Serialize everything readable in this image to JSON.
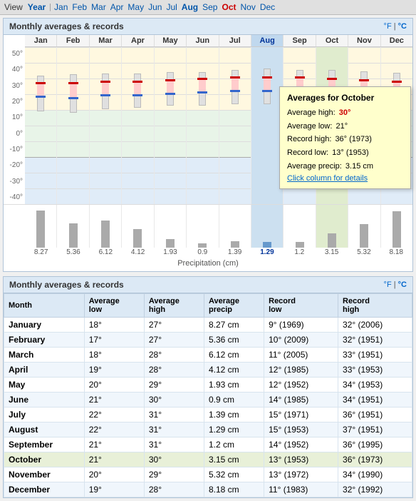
{
  "nav": {
    "view_label": "View",
    "year_label": "Year",
    "months": [
      "Jan",
      "Feb",
      "Mar",
      "Apr",
      "May",
      "Jun",
      "Jul",
      "Aug",
      "Sep",
      "Oct",
      "Nov",
      "Dec"
    ],
    "current_month": "Oct"
  },
  "chart": {
    "title": "Monthly averages & records",
    "temp_f": "°F",
    "temp_separator": " | ",
    "temp_c": "°C",
    "y_labels": [
      "50°",
      "40°",
      "30°",
      "20°",
      "10°",
      "0°",
      "-10°",
      "-20°",
      "-30°",
      "-40°"
    ],
    "months": [
      "Jan",
      "Feb",
      "Mar",
      "Apr",
      "May",
      "Jun",
      "Jul",
      "Aug",
      "Sep",
      "Oct",
      "Nov",
      "Dec"
    ],
    "highlighted_month": "Aug",
    "precip_title": "Precipitation (cm)",
    "precip_values": [
      "8.27",
      "5.36",
      "6.12",
      "4.12",
      "1.93",
      "0.9",
      "1.39",
      "1.29",
      "1.2",
      "3.15",
      "5.32",
      "8.18"
    ],
    "precip_heights": [
      52,
      34,
      38,
      26,
      12,
      6,
      9,
      8,
      8,
      20,
      33,
      51
    ]
  },
  "tooltip": {
    "title": "Averages for October",
    "avg_high_label": "Average high:",
    "avg_high_value": "30°",
    "avg_low_label": "Average low:",
    "avg_low_value": "21°",
    "record_high_label": "Record high:",
    "record_high_value": "36° (1973)",
    "record_low_label": "Record low:",
    "record_low_value": "13° (1953)",
    "avg_precip_label": "Average precip:",
    "avg_precip_value": "3.15 cm",
    "link_text": "Click column for details"
  },
  "table": {
    "title": "Monthly averages & records",
    "temp_f": "°F",
    "temp_separator": " | ",
    "temp_c": "°C",
    "headers": [
      "Month",
      "Average low",
      "Average high",
      "Average precip",
      "Record low",
      "Record high"
    ],
    "rows": [
      {
        "month": "January",
        "avg_low": "18°",
        "avg_high": "27°",
        "avg_precip": "8.27 cm",
        "record_low": "9° (1969)",
        "record_high": "32° (2006)"
      },
      {
        "month": "February",
        "avg_low": "17°",
        "avg_high": "27°",
        "avg_precip": "5.36 cm",
        "record_low": "10° (2009)",
        "record_high": "32° (1951)"
      },
      {
        "month": "March",
        "avg_low": "18°",
        "avg_high": "28°",
        "avg_precip": "6.12 cm",
        "record_low": "11° (2005)",
        "record_high": "33° (1951)"
      },
      {
        "month": "April",
        "avg_low": "19°",
        "avg_high": "28°",
        "avg_precip": "4.12 cm",
        "record_low": "12° (1985)",
        "record_high": "33° (1953)"
      },
      {
        "month": "May",
        "avg_low": "20°",
        "avg_high": "29°",
        "avg_precip": "1.93 cm",
        "record_low": "12° (1952)",
        "record_high": "34° (1953)"
      },
      {
        "month": "June",
        "avg_low": "21°",
        "avg_high": "30°",
        "avg_precip": "0.9 cm",
        "record_low": "14° (1985)",
        "record_high": "34° (1951)"
      },
      {
        "month": "July",
        "avg_low": "22°",
        "avg_high": "31°",
        "avg_precip": "1.39 cm",
        "record_low": "15° (1971)",
        "record_high": "36° (1951)"
      },
      {
        "month": "August",
        "avg_low": "22°",
        "avg_high": "31°",
        "avg_precip": "1.29 cm",
        "record_low": "15° (1953)",
        "record_high": "37° (1951)"
      },
      {
        "month": "September",
        "avg_low": "21°",
        "avg_high": "31°",
        "avg_precip": "1.2 cm",
        "record_low": "14° (1952)",
        "record_high": "36° (1995)"
      },
      {
        "month": "October",
        "avg_low": "21°",
        "avg_high": "30°",
        "avg_precip": "3.15 cm",
        "record_low": "13° (1953)",
        "record_high": "36° (1973)"
      },
      {
        "month": "November",
        "avg_low": "20°",
        "avg_high": "29°",
        "avg_precip": "5.32 cm",
        "record_low": "13° (1972)",
        "record_high": "34° (1990)"
      },
      {
        "month": "December",
        "avg_low": "19°",
        "avg_high": "28°",
        "avg_precip": "8.18 cm",
        "record_low": "11° (1983)",
        "record_high": "32° (1992)"
      }
    ]
  }
}
